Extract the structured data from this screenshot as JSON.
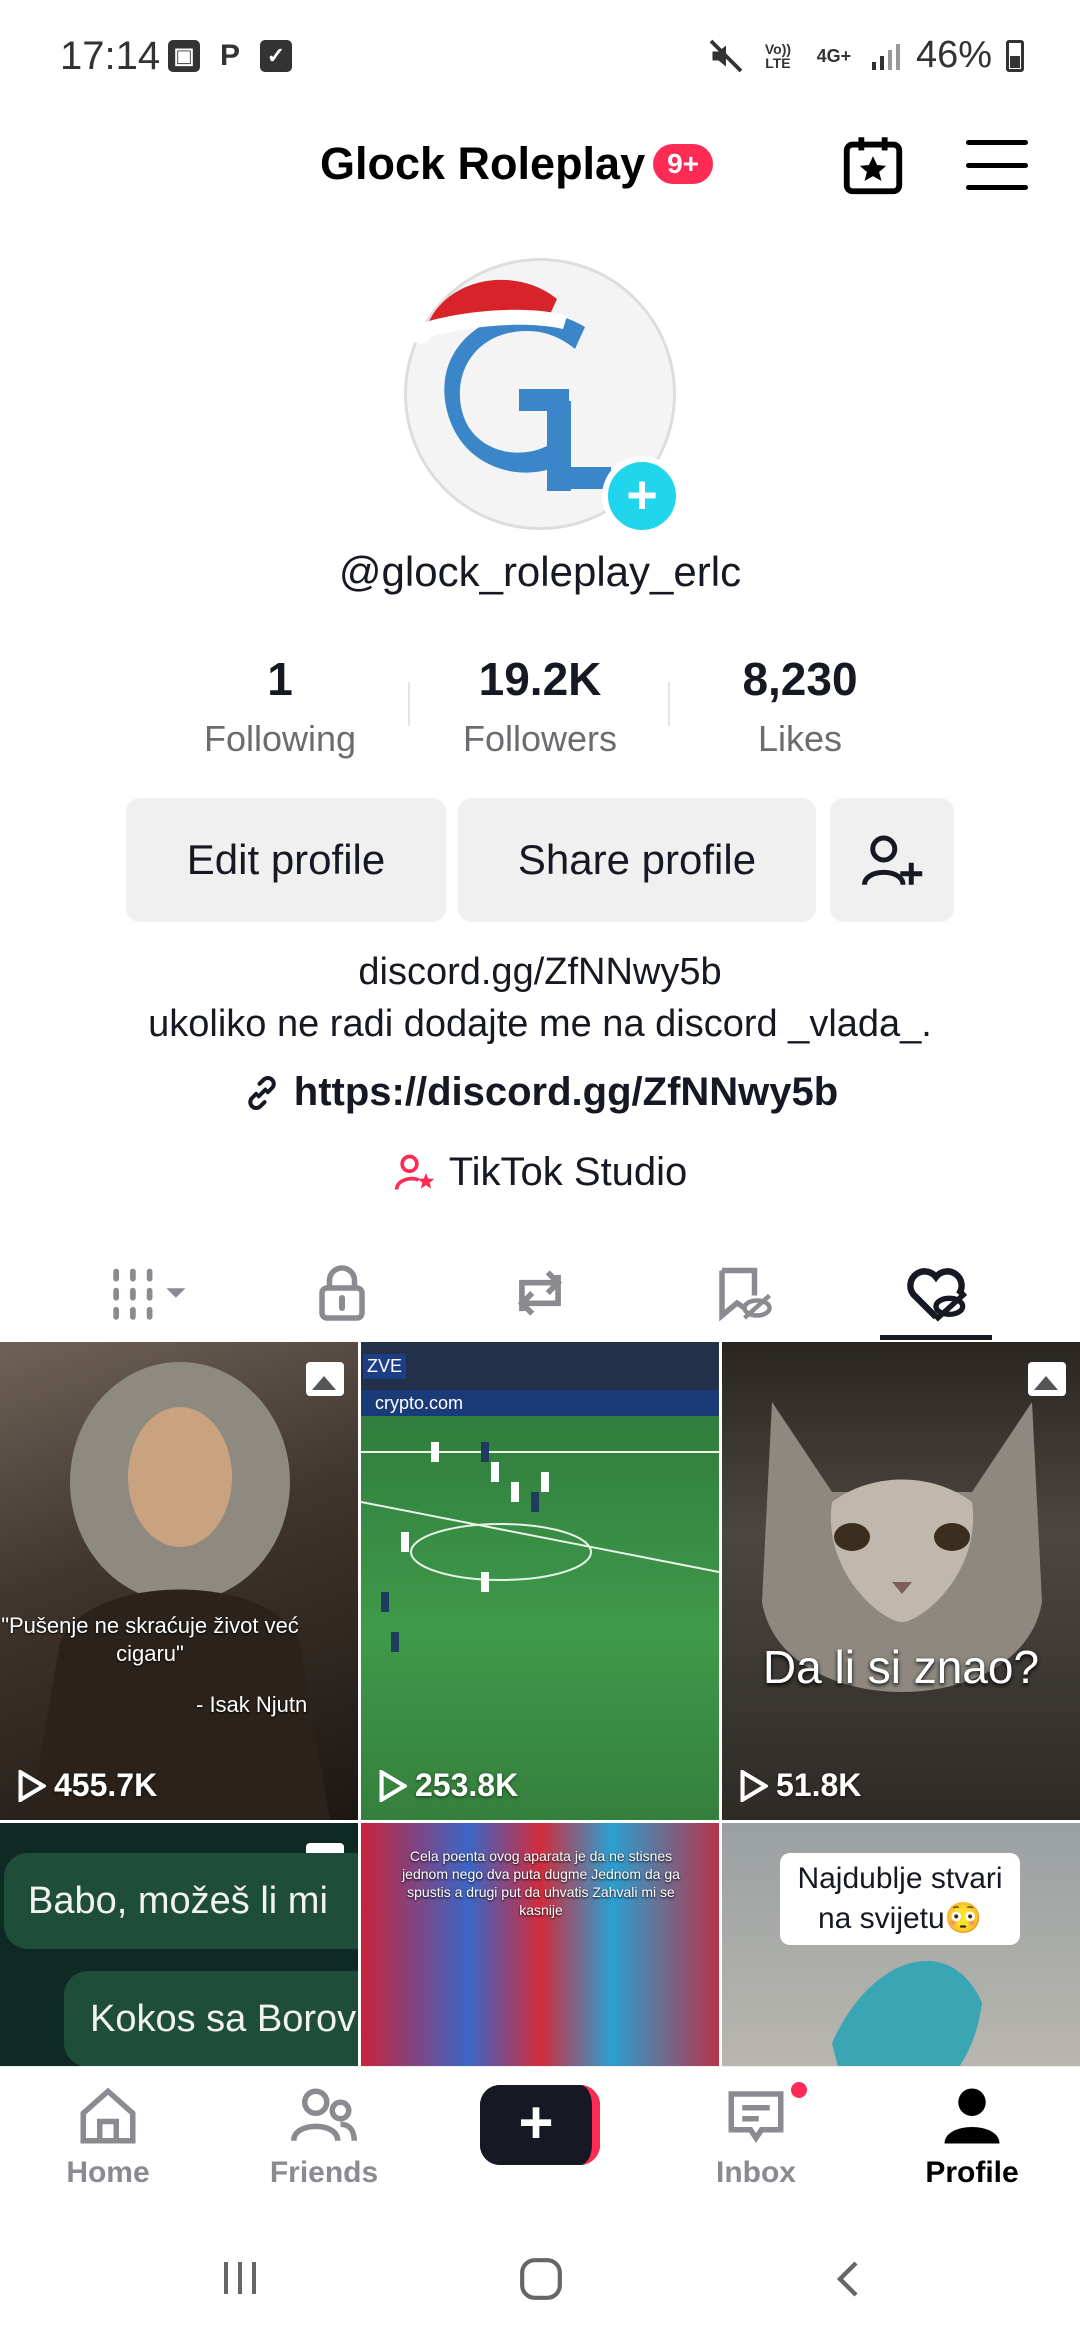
{
  "status_bar": {
    "time": "17:14",
    "battery": "46%",
    "network_top": "Vo)) LTE",
    "network_4g": "4G+"
  },
  "header": {
    "title": "Glock Roleplay",
    "notification_badge": "9+"
  },
  "profile": {
    "handle": "@glock_roleplay_erlc",
    "stats": [
      {
        "value": "1",
        "label": "Following"
      },
      {
        "value": "19.2K",
        "label": "Followers"
      },
      {
        "value": "8,230",
        "label": "Likes"
      }
    ],
    "edit_label": "Edit profile",
    "share_label": "Share profile",
    "bio_line1": "discord.gg/ZfNNwy5b",
    "bio_line2": "ukoliko ne radi dodajte me na discord _vlada_.",
    "link": "https://discord.gg/ZfNNwy5b",
    "studio": "TikTok Studio"
  },
  "tabs": [
    "videos-grid",
    "private",
    "reposts",
    "favorites",
    "liked"
  ],
  "videos": [
    {
      "views": "455.7K",
      "caption": "\"Pušenje ne skraćuje život već cigaru\"",
      "caption2": "- Isak Njutn"
    },
    {
      "views": "253.8K",
      "banner": "crypto.com",
      "label": "ZVE"
    },
    {
      "views": "51.8K",
      "caption": "Da li si znao?"
    },
    {
      "caption": "Babo, možeš li mi",
      "caption2": "Kokos sa Borov"
    },
    {
      "caption": "Cela poenta ovog aparata je da ne stisnes jednom nego dva puta dugme Jednom da ga spustis a drugi put da uhvatis Zahvali mi se kasnije"
    },
    {
      "caption": "Najdublje stvari na svijetu😳"
    }
  ],
  "nav": {
    "home": "Home",
    "friends": "Friends",
    "inbox": "Inbox",
    "profile": "Profile"
  },
  "colors": {
    "accent": "#fe2c55",
    "cyan": "#20d5ec",
    "text": "#161823"
  }
}
